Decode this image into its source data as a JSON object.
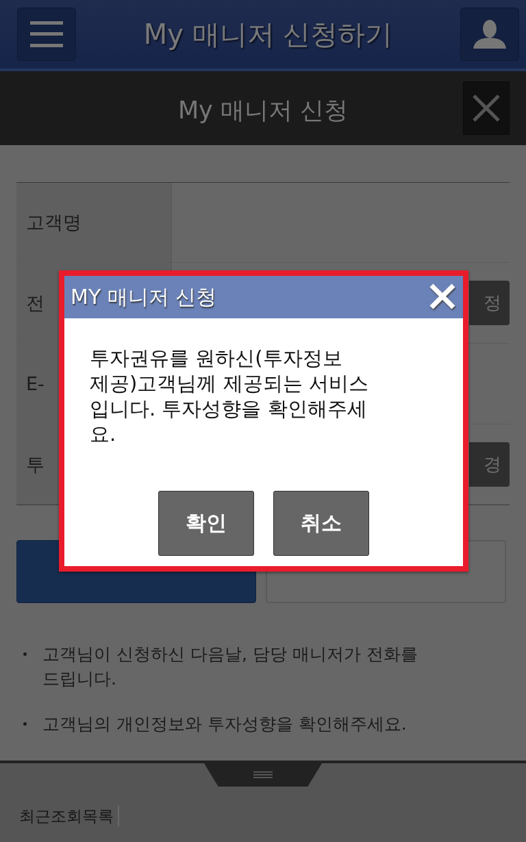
{
  "header": {
    "title": "My 매니저 신청하기"
  },
  "page_bar": {
    "title": "My 매니저 신청"
  },
  "form": {
    "rows": [
      {
        "label": "고객명",
        "kind": "text"
      },
      {
        "label": "전",
        "kind": "button",
        "button": "정"
      },
      {
        "label": "E-",
        "kind": "text"
      },
      {
        "label": "투",
        "kind": "button",
        "button": "경"
      }
    ]
  },
  "actions": [
    {
      "kind": "primary"
    },
    {
      "kind": "secondary"
    }
  ],
  "notes": [
    "고객님이 신청하신 다음날, 담당 매니저가 전화를 드립니다.",
    "고객님의 개인정보와 투자성향을 확인해주세요."
  ],
  "footer": {
    "tab": "최근조회목록"
  },
  "dialog": {
    "title": "MY 매니저 신청",
    "message_lines": [
      "투자권유를 원하신(투자정보",
      "제공)고객님께 제공되는 서비스",
      "입니다. 투자성향을 확인해주세요."
    ],
    "buttons": [
      "확인",
      "취소"
    ]
  }
}
